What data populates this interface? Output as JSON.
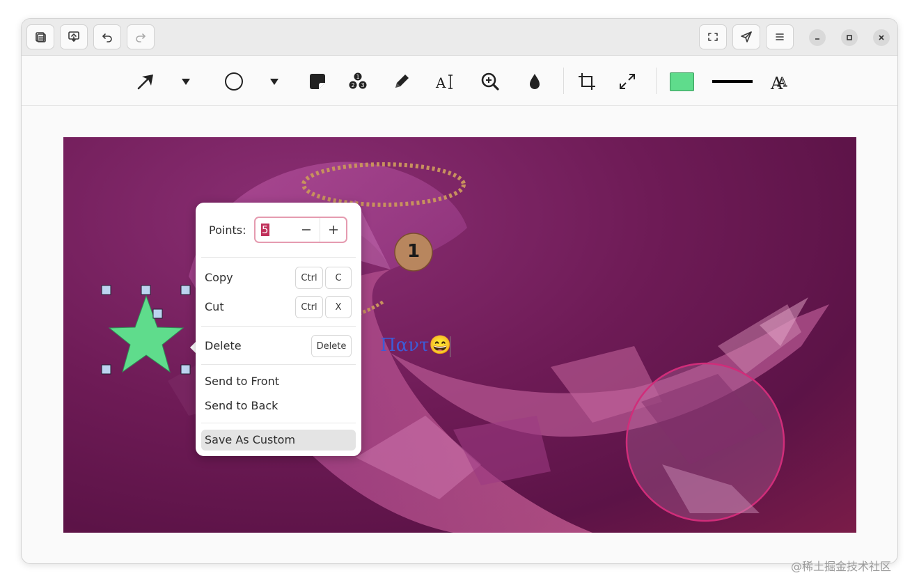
{
  "header": {
    "buttons": {
      "menu_left": "document-icon",
      "save": "image-save-icon",
      "undo": "undo-icon",
      "redo": "redo-icon",
      "capture": "screenshot-region-icon",
      "send": "send-icon",
      "menu": "hamburger-menu-icon"
    }
  },
  "toolbar": {
    "tools": [
      "arrow-tool",
      "dropdown",
      "ellipse-tool",
      "dropdown",
      "sticker-tool",
      "numbered-marker-tool",
      "pencil-tool",
      "text-tool",
      "magnifier-tool",
      "blur-tool",
      "crop-tool",
      "resize-tool"
    ],
    "fill_color": "#5fdc8c",
    "stroke_color": "#000000"
  },
  "canvas": {
    "counter_label": "1",
    "text_item": "Παντ😄",
    "star_color": "#5fdc8c",
    "marker_color": "#b8865e"
  },
  "context_menu": {
    "points_label": "Points:",
    "points_value": "5",
    "copy_label": "Copy",
    "copy_keys": [
      "Ctrl",
      "C"
    ],
    "cut_label": "Cut",
    "cut_keys": [
      "Ctrl",
      "X"
    ],
    "delete_label": "Delete",
    "delete_key": "Delete",
    "send_front_label": "Send to Front",
    "send_back_label": "Send to Back",
    "save_custom_label": "Save As Custom"
  },
  "watermark": "@稀土掘金技术社区"
}
